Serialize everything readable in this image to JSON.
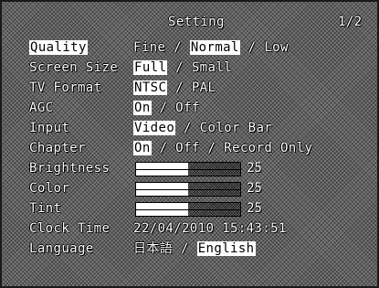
{
  "header": {
    "title": "Setting",
    "page": "1/2"
  },
  "rows": {
    "quality": {
      "label": "Quality",
      "opt1": "Fine",
      "sep1": " / ",
      "opt2": "Normal",
      "sep2": " / ",
      "opt3": "Low",
      "selected": "Normal"
    },
    "screen": {
      "label": "Screen Size",
      "opt1": "Full",
      "sep1": " / ",
      "opt2": "Small",
      "selected": "Full"
    },
    "tv": {
      "label": "TV Format",
      "opt1": "NTSC",
      "sep1": " / ",
      "opt2": "PAL",
      "selected": "NTSC"
    },
    "agc": {
      "label": "AGC",
      "opt1": "On",
      "sep1": " / ",
      "opt2": "Off",
      "selected": "On"
    },
    "input": {
      "label": "Input",
      "opt1": "Video",
      "sep1": " / ",
      "opt2": "Color Bar",
      "selected": "Video"
    },
    "chapter": {
      "label": "Chapter",
      "opt1": "On",
      "sep1": " / ",
      "opt2": "Off",
      "sep2": " / ",
      "opt3": "Record Only",
      "selected": "On"
    },
    "brightness": {
      "label": "Brightness",
      "value": "25",
      "level": 0.5
    },
    "color": {
      "label": "Color",
      "value": "25",
      "level": 0.5
    },
    "tint": {
      "label": "Tint",
      "value": "25",
      "level": 0.5
    },
    "clock": {
      "label": "Clock Time",
      "value": "22/04/2010 15:43:51"
    },
    "language": {
      "label": "Language",
      "opt1": "日本語",
      "sep1": " / ",
      "opt2": "English",
      "selected": "English"
    }
  },
  "colors": {
    "background": "#7a7a7a",
    "text": "#ffffff",
    "highlight": "#ffffff",
    "highlight_text": "#000000"
  }
}
